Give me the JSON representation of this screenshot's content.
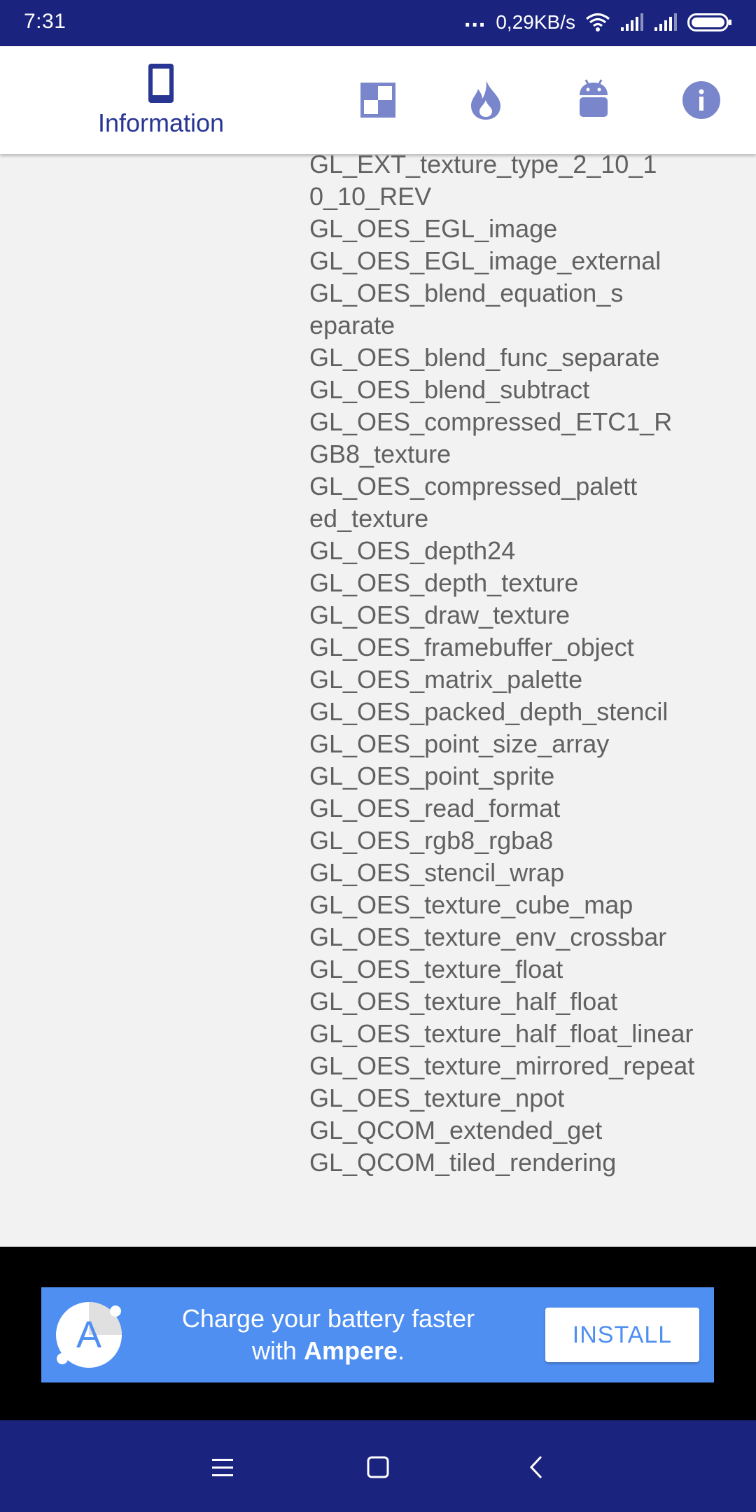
{
  "status_bar": {
    "time": "7:31",
    "dots": "...",
    "speed": "0,29KB/s",
    "icons": [
      "wifi-icon",
      "signal-icon",
      "signal-icon",
      "battery-icon"
    ]
  },
  "tabs": [
    {
      "name": "information",
      "label": "Information",
      "icon": "phone-icon",
      "active": true
    },
    {
      "name": "display",
      "label": "",
      "icon": "checker-icon",
      "active": false
    },
    {
      "name": "cpu",
      "label": "",
      "icon": "flame-icon",
      "active": false
    },
    {
      "name": "android",
      "label": "",
      "icon": "android-icon",
      "active": false
    },
    {
      "name": "about",
      "label": "",
      "icon": "info-icon",
      "active": false
    }
  ],
  "extensions": [
    "GL_EXT_texture_type_2_10_1",
    "0_10_REV",
    "GL_OES_EGL_image",
    "GL_OES_EGL_image_external",
    "GL_OES_blend_equation_s",
    "eparate",
    "GL_OES_blend_func_separate",
    "GL_OES_blend_subtract",
    "GL_OES_compressed_ETC1_R",
    "GB8_texture",
    "GL_OES_compressed_palett",
    "ed_texture",
    "GL_OES_depth24",
    "GL_OES_depth_texture",
    "GL_OES_draw_texture",
    "GL_OES_framebuffer_object",
    "GL_OES_matrix_palette",
    "GL_OES_packed_depth_stencil",
    "GL_OES_point_size_array",
    "GL_OES_point_sprite",
    "GL_OES_read_format",
    "GL_OES_rgb8_rgba8",
    "GL_OES_stencil_wrap",
    "GL_OES_texture_cube_map",
    "GL_OES_texture_env_crossbar",
    "GL_OES_texture_float",
    "GL_OES_texture_half_float",
    "GL_OES_texture_half_float_linear",
    "GL_OES_texture_mirrored_repeat",
    "GL_OES_texture_npot",
    "GL_QCOM_extended_get",
    "GL_QCOM_tiled_rendering"
  ],
  "ad": {
    "logo_letter": "A",
    "text_line1": "Charge your battery faster",
    "text_with": "with",
    "text_brand": "Ampere",
    "text_end": ".",
    "button": "INSTALL"
  },
  "navigation": {
    "buttons": [
      "menu-icon",
      "home-icon",
      "back-icon"
    ]
  },
  "colors": {
    "primary_dark": "#1a237e",
    "accent": "#283593",
    "tab_icon": "#7986cb",
    "ad_blue": "#4f8ff1"
  }
}
